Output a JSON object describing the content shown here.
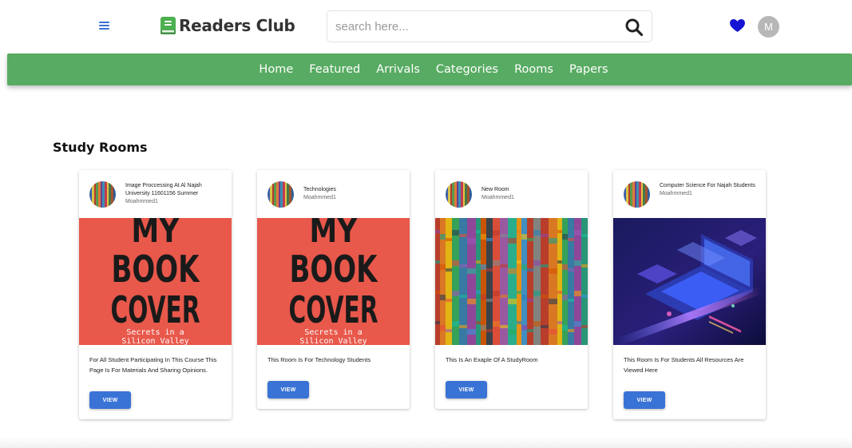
{
  "header": {
    "brand_name": "Readers Club",
    "search": {
      "placeholder": "search here..."
    },
    "user_initial": "M",
    "colors": {
      "brand_green": "#4caf50",
      "heart": "#1414d2",
      "avatar_bg": "#b7b7b7"
    }
  },
  "nav": {
    "items": [
      "Home",
      "Featured",
      "Arrivals",
      "Categories",
      "Rooms",
      "Papers"
    ],
    "color": "#58ab62"
  },
  "main": {
    "section_title": "Study Rooms",
    "rooms": [
      {
        "title": "Image Proccessing At Al Najah University 11601156 Summer",
        "owner": "Moahmmed1",
        "description": "For All Student Participating In This Course This Page Is For Materials And Sharing Opinions.",
        "cover": {
          "type": "book-cover",
          "lines": [
            "MY",
            "BOOK",
            "COVER"
          ],
          "subtitle_lines": [
            "Secrets in a",
            "Silicon Valley"
          ]
        },
        "button": "VIEW"
      },
      {
        "title": "Technologies",
        "owner": "Moahmmed1",
        "description": "This Room Is For Technology Students",
        "cover": {
          "type": "book-cover",
          "lines": [
            "MY",
            "BOOK",
            "COVER"
          ],
          "subtitle_lines": [
            "Secrets in a",
            "Silicon Valley"
          ]
        },
        "button": "VIEW"
      },
      {
        "title": "New Room",
        "owner": "Moahmmed1",
        "description": "This Is An Exaple Of A StudyRoom",
        "cover": {
          "type": "colorful-book-spines"
        },
        "button": "VIEW"
      },
      {
        "title": "Computer Science For Najah Students",
        "owner": "Moahmmed1",
        "description": "This Room Is For Students All Resources Are Viewed Here",
        "cover": {
          "type": "isometric-laptop"
        },
        "button": "VIEW"
      }
    ],
    "button_color": "#3a73d6"
  }
}
